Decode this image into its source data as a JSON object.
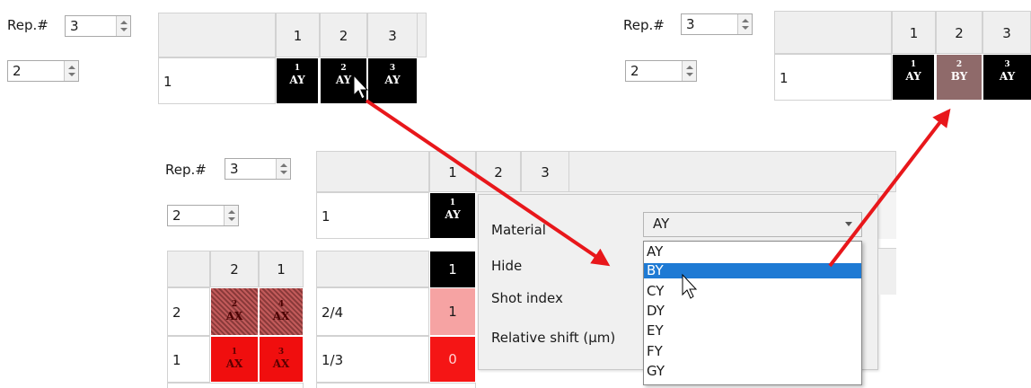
{
  "panel_before": {
    "rep_label": "Rep.#",
    "rep_value": "3",
    "second_value": "2",
    "columns": [
      "1",
      "2",
      "3"
    ],
    "row_label": "1",
    "cells": [
      {
        "num": "1",
        "mat": "AY"
      },
      {
        "num": "2",
        "mat": "AY"
      },
      {
        "num": "3",
        "mat": "AY"
      }
    ]
  },
  "panel_after": {
    "rep_label": "Rep.#",
    "rep_value": "3",
    "second_value": "2",
    "columns": [
      "1",
      "2",
      "3"
    ],
    "row_label": "1",
    "cells": [
      {
        "num": "1",
        "mat": "AY"
      },
      {
        "num": "2",
        "mat": "BY"
      },
      {
        "num": "3",
        "mat": "AY"
      }
    ]
  },
  "panel_main": {
    "rep_label": "Rep.#",
    "rep_value": "3",
    "second_value": "2",
    "columns": [
      "1",
      "2",
      "3"
    ],
    "row_label": "1",
    "cell": {
      "num": "1",
      "mat": "AY"
    },
    "left_columns": [
      "2",
      "1"
    ],
    "left_rows": [
      {
        "label": "2",
        "cells": [
          {
            "num": "2",
            "mat": "AX"
          },
          {
            "num": "4",
            "mat": "AX"
          }
        ]
      },
      {
        "label": "1",
        "cells": [
          {
            "num": "1",
            "mat": "AX"
          },
          {
            "num": "3",
            "mat": "AX"
          }
        ]
      }
    ],
    "right_header": "1",
    "right_rows": [
      {
        "label": "2/4",
        "value": "1"
      },
      {
        "label": "1/3",
        "value": "0"
      }
    ],
    "context_menu": [
      "Material",
      "Hide",
      "Shot index",
      "Relative shift (µm)"
    ],
    "combo_value": "AY",
    "options": [
      "AY",
      "BY",
      "CY",
      "DY",
      "EY",
      "FY",
      "GY"
    ],
    "selected_option": "BY"
  },
  "colors": {
    "arrow": "#e8171b",
    "cell_black": "#000000",
    "cell_brown": "#8f6a6a",
    "cell_red": "#f00e0e",
    "selection_blue": "#1e7ad4"
  }
}
